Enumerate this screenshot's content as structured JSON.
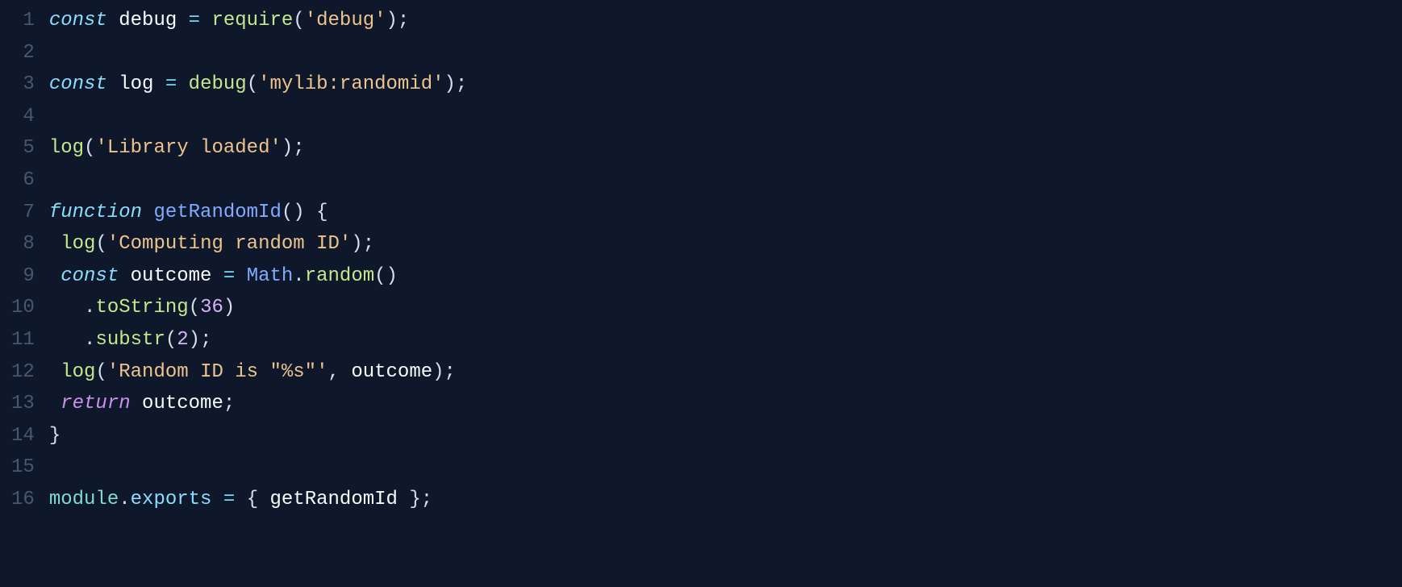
{
  "editor": {
    "language": "javascript",
    "lines": [
      {
        "num": "1",
        "tokens": [
          {
            "t": "const ",
            "c": "tk-keyword"
          },
          {
            "t": "debug",
            "c": "tk-var"
          },
          {
            "t": " = ",
            "c": "tk-op"
          },
          {
            "t": "require",
            "c": "tk-call"
          },
          {
            "t": "(",
            "c": "tk-punct"
          },
          {
            "t": "'debug'",
            "c": "tk-string"
          },
          {
            "t": ");",
            "c": "tk-punct"
          }
        ]
      },
      {
        "num": "2",
        "tokens": []
      },
      {
        "num": "3",
        "tokens": [
          {
            "t": "const ",
            "c": "tk-keyword"
          },
          {
            "t": "log",
            "c": "tk-var"
          },
          {
            "t": " = ",
            "c": "tk-op"
          },
          {
            "t": "debug",
            "c": "tk-call"
          },
          {
            "t": "(",
            "c": "tk-punct"
          },
          {
            "t": "'mylib:randomid'",
            "c": "tk-string"
          },
          {
            "t": ");",
            "c": "tk-punct"
          }
        ]
      },
      {
        "num": "4",
        "tokens": []
      },
      {
        "num": "5",
        "tokens": [
          {
            "t": "log",
            "c": "tk-call"
          },
          {
            "t": "(",
            "c": "tk-punct"
          },
          {
            "t": "'Library loaded'",
            "c": "tk-string"
          },
          {
            "t": ");",
            "c": "tk-punct"
          }
        ]
      },
      {
        "num": "6",
        "tokens": []
      },
      {
        "num": "7",
        "tokens": [
          {
            "t": "function ",
            "c": "tk-keyword"
          },
          {
            "t": "getRandomId",
            "c": "tk-func"
          },
          {
            "t": "()",
            "c": "tk-punct"
          },
          {
            "t": " {",
            "c": "tk-punct"
          }
        ]
      },
      {
        "num": "8",
        "tokens": [
          {
            "t": " ",
            "c": "tk-plain"
          },
          {
            "t": "log",
            "c": "tk-call"
          },
          {
            "t": "(",
            "c": "tk-punct"
          },
          {
            "t": "'Computing random ID'",
            "c": "tk-string"
          },
          {
            "t": ");",
            "c": "tk-punct"
          }
        ]
      },
      {
        "num": "9",
        "tokens": [
          {
            "t": " ",
            "c": "tk-plain"
          },
          {
            "t": "const ",
            "c": "tk-keyword"
          },
          {
            "t": "outcome",
            "c": "tk-var"
          },
          {
            "t": " = ",
            "c": "tk-op"
          },
          {
            "t": "Math",
            "c": "tk-builtin"
          },
          {
            "t": ".",
            "c": "tk-punct"
          },
          {
            "t": "random",
            "c": "tk-call"
          },
          {
            "t": "()",
            "c": "tk-punct"
          }
        ]
      },
      {
        "num": "10",
        "tokens": [
          {
            "t": "   ",
            "c": "tk-plain"
          },
          {
            "t": ".",
            "c": "tk-punct"
          },
          {
            "t": "toString",
            "c": "tk-call"
          },
          {
            "t": "(",
            "c": "tk-punct"
          },
          {
            "t": "36",
            "c": "tk-number"
          },
          {
            "t": ")",
            "c": "tk-punct"
          }
        ]
      },
      {
        "num": "11",
        "tokens": [
          {
            "t": "   ",
            "c": "tk-plain"
          },
          {
            "t": ".",
            "c": "tk-punct"
          },
          {
            "t": "substr",
            "c": "tk-call"
          },
          {
            "t": "(",
            "c": "tk-punct"
          },
          {
            "t": "2",
            "c": "tk-number"
          },
          {
            "t": ");",
            "c": "tk-punct"
          }
        ]
      },
      {
        "num": "12",
        "tokens": [
          {
            "t": " ",
            "c": "tk-plain"
          },
          {
            "t": "log",
            "c": "tk-call"
          },
          {
            "t": "(",
            "c": "tk-punct"
          },
          {
            "t": "'Random ID is \"%s\"'",
            "c": "tk-string"
          },
          {
            "t": ", ",
            "c": "tk-punct"
          },
          {
            "t": "outcome",
            "c": "tk-var"
          },
          {
            "t": ");",
            "c": "tk-punct"
          }
        ]
      },
      {
        "num": "13",
        "tokens": [
          {
            "t": " ",
            "c": "tk-plain"
          },
          {
            "t": "return ",
            "c": "tk-keyword2"
          },
          {
            "t": "outcome",
            "c": "tk-var"
          },
          {
            "t": ";",
            "c": "tk-punct"
          }
        ]
      },
      {
        "num": "14",
        "tokens": [
          {
            "t": "}",
            "c": "tk-punct"
          }
        ]
      },
      {
        "num": "15",
        "tokens": []
      },
      {
        "num": "16",
        "tokens": [
          {
            "t": "module",
            "c": "tk-module"
          },
          {
            "t": ".",
            "c": "tk-punct"
          },
          {
            "t": "exports",
            "c": "tk-prop"
          },
          {
            "t": " = ",
            "c": "tk-op"
          },
          {
            "t": "{ ",
            "c": "tk-punct"
          },
          {
            "t": "getRandomId",
            "c": "tk-var"
          },
          {
            "t": " };",
            "c": "tk-punct"
          }
        ]
      }
    ]
  }
}
